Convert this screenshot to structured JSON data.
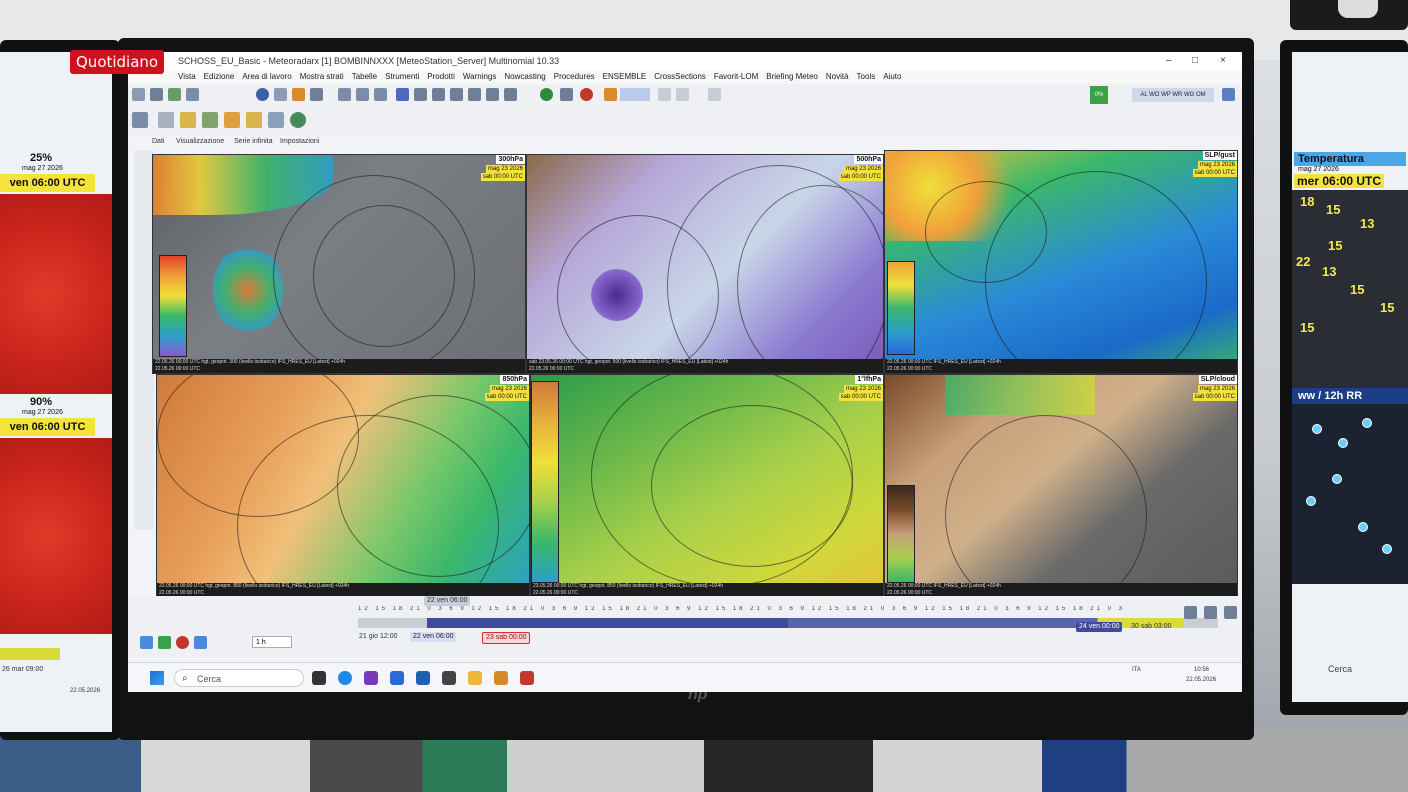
{
  "channel_badge": "Quotidiano",
  "window": {
    "title": "SCHOSS_EU_Basic - Meteoradarx [1] BOMBINNXXX [MeteoStation_Server] Multinomial 10.33",
    "controls": [
      "–",
      "□",
      "×"
    ]
  },
  "menu": [
    "Vista",
    "Edizione",
    "Area di lavoro",
    "Mostra strati",
    "Tabelle",
    "Strumenti",
    "Prodotti",
    "Warnings",
    "Nowcasting",
    "Procedures",
    "ENSEMBLE",
    "CrossSections",
    "Favorit-LOM",
    "Briefing Meteo",
    "Novità",
    "Tools",
    "Aiuto"
  ],
  "toolbar": {
    "right_button": "AL WO WP WR WG OM",
    "percent": "0%"
  },
  "subtabs": [
    "Dati",
    "Visualizzazione",
    "Serie infinita",
    "Impostazioni"
  ],
  "panels": [
    {
      "label": "300hPa",
      "date": "mag 23 2026",
      "date2": "sab 00:00 UTC",
      "foot1": "22.05.26 00:00 UTC   hgt, geopot. 300 (livello isobarico) IFS_HRES_EU [Latest] +024h",
      "foot2": "22.05.26 00:00 UTC"
    },
    {
      "label": "500hPa",
      "date": "mag 23 2026",
      "date2": "sab 00:00 UTC",
      "foot1": "sab 23.05.26 00:00 UTC  hgt, geopot. 500 (livello isobarico) IFS_HRES_EU [Latest] +024h",
      "foot2": "22.05.26 00:00 UTC"
    },
    {
      "label": "SLP/gust",
      "date": "mag 23 2026",
      "date2": "sab 00:00 UTC",
      "foot1": "22.05.26 00:00 UTC   IFS_HRES_EU [Latest] +024h",
      "foot2": "22.05.26 00:00 UTC"
    },
    {
      "label": "850hPa",
      "date": "mag 23 2026",
      "date2": "sab 00:00 UTC",
      "foot1": "22.05.26 00:00 UTC   hgt, geopot. 850 (livello isobarico) IFS_HRES_EU [Latest] +024h",
      "foot2": "22.05.26 00:00 UTC"
    },
    {
      "label": "1°lfhPa",
      "date": "mag 23 2026",
      "date2": "sab 00:00 UTC",
      "foot1": "23.05.26 00:00 UTC  hgt, geopot. 850 (livello isobarico) IFS_HRES_EU [Latest] +024h",
      "foot2": "22.05.26 00:00 UTC"
    },
    {
      "label": "SLP/cloud",
      "date": "mag 23 2026",
      "date2": "sab 00:00 UTC",
      "foot1": "22.05.26 00:00 UTC   IFS_HRES_EU [Latest] +024h",
      "foot2": "22.05.26 00:00 UTC"
    }
  ],
  "timeline": {
    "ticks": "12 15 18 21 0 3 6 9 12 15 18 21 0 3 6 9 12 15 18 21 0 3 6 9 12 15 18 21 0 3 6 9 12 15 18 21 0 3 6 9 12 15 18 21 0 3 6 9 12 15 18 21 0 3",
    "step": "1 h",
    "start": "21 gio 12:00",
    "current": "22 ven 06:00",
    "selected": "23 sab 00:00",
    "end_left": "24 ven 00:00",
    "end_right": "30 sab 03:00",
    "top_chip": "22 ven 06:00"
  },
  "taskbar": {
    "search": "Cerca",
    "lang": "ITA",
    "time": "10:56",
    "date": "22.05.2026"
  },
  "left_monitor": {
    "pct1": "25%",
    "date1": "mag 27 2026",
    "banner1": "ven 06:00 UTC",
    "pct2": "90%",
    "date2": "mag 27 2026",
    "banner2": "ven 06:00 UTC",
    "foot_date": "26 mar 09:00",
    "foot_date2": "22.05.2026"
  },
  "right_monitor": {
    "title": "Temperatura",
    "date": "mag 27 2026",
    "time": "mer 06:00 UTC",
    "values": [
      "18",
      "15",
      "13",
      "15",
      "22",
      "13",
      "15",
      "15",
      "15"
    ],
    "ww": "ww / 12h RR",
    "search": "Cerca"
  },
  "colors": {
    "badge": "#d0101e",
    "highlight": "#f3e23b",
    "timeline": "#3e4a9c"
  }
}
